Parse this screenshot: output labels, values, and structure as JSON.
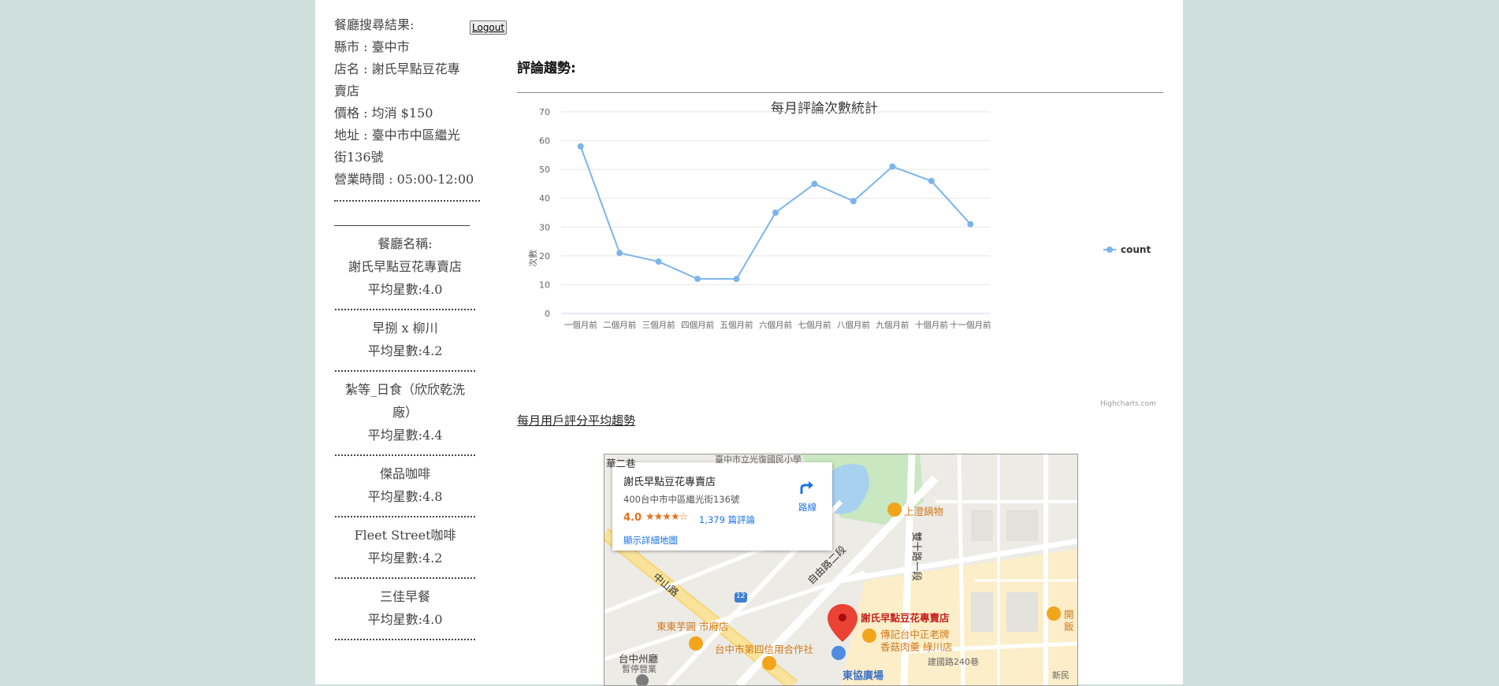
{
  "sidebar": {
    "info_lines": [
      "餐廳搜尋結果:",
      "縣市 : 臺中市",
      "店名 : 謝氏早點豆花專",
      "賣店",
      "價格 : 均消 $150",
      "地址 : 臺中市中區繼光",
      "街136號",
      "營業時間 : 05:00-12:00"
    ],
    "logout_label": "Logout",
    "list_heading": "餐廳名稱:",
    "restaurants": [
      {
        "name": "謝氏早點豆花專賣店",
        "rating": "平均星數:4.0"
      },
      {
        "name": "早捌 x 柳川",
        "rating": "平均星數:4.2"
      },
      {
        "name": "紮等_日食（欣欣乾洗",
        "name2": "廠）",
        "rating": "平均星數:4.4"
      },
      {
        "name": "傑品咖啡",
        "rating": "平均星數:4.8"
      },
      {
        "name": "Fleet Street咖啡",
        "rating": "平均星數:4.2"
      },
      {
        "name": "三佳早餐",
        "rating": "平均星數:4.0"
      }
    ]
  },
  "main": {
    "section_title": "評論趨勢:",
    "trend_link": "每月用戶評分平均趨勢"
  },
  "chart_data": {
    "type": "line",
    "title": "每月評論次數統計",
    "xlabel": "",
    "ylabel": "次數",
    "categories": [
      "一個月前",
      "二個月前",
      "三個月前",
      "四個月前",
      "五個月前",
      "六個月前",
      "七個月前",
      "八個月前",
      "九個月前",
      "十個月前",
      "十一個月前"
    ],
    "series": [
      {
        "name": "count",
        "values": [
          58,
          21,
          18,
          12,
          12,
          35,
          45,
          39,
          51,
          46,
          31
        ]
      }
    ],
    "ylim": [
      0,
      70
    ],
    "yticks": [
      0,
      10,
      20,
      30,
      40,
      50,
      60,
      70
    ],
    "grid": true,
    "legend": "right",
    "credits": "Highcharts.com",
    "color": "#7cb5ec"
  },
  "map": {
    "card": {
      "name": "謝氏早點豆花專賣店",
      "address": "400台中市中區繼光街136號",
      "rating": "4.0",
      "stars": "★★★★☆",
      "reviews": "1,379 篇評論",
      "directions": "路線",
      "larger_map": "顯示詳細地圖"
    },
    "labels": {
      "pin": "謝氏早點豆花專賣店",
      "hotpot": "上澄鍋物",
      "taro": "東東芋圓 市府店",
      "coop": "台中市第四信用合作社",
      "noodle1": "傳記台中正老牌",
      "noodle2": "香菇肉羹 綠川店",
      "plaza": "東協廣場",
      "hall": "台中州廳",
      "hall_sub": "暫停營業",
      "zhongshan": "中山路",
      "ziyou": "自由路二段",
      "shuangshi": "雙十路一段",
      "school": "臺中市立光復國民小學",
      "partial": "華二巷",
      "kai": "開",
      "fan": "飯",
      "sheng": "新民",
      "jianguo": "建國路240巷",
      "route": "12"
    }
  },
  "colors": {
    "background": "#cfdfdc",
    "series": "#7cb5ec",
    "pin": "#ea4335",
    "poi": "#f2a41c"
  }
}
